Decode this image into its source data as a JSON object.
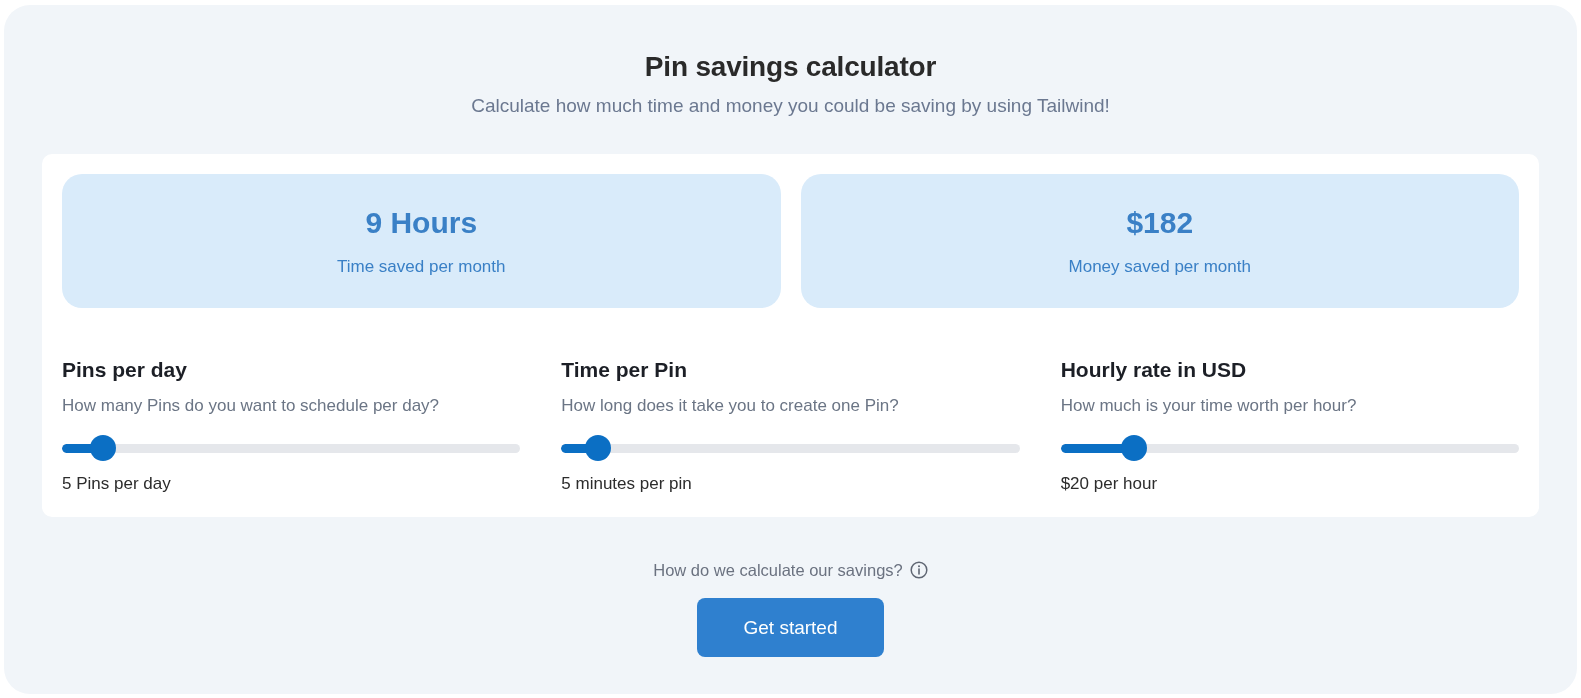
{
  "header": {
    "title": "Pin savings calculator",
    "subtitle": "Calculate how much time and money you could be saving by using Tailwind!"
  },
  "results": [
    {
      "value": "9 Hours",
      "label": "Time saved per month"
    },
    {
      "value": "$182",
      "label": "Money saved per month"
    }
  ],
  "sliders": [
    {
      "title": "Pins per day",
      "question": "How many Pins do you want to schedule per day?",
      "level": 0.09,
      "reading": "5 Pins per day"
    },
    {
      "title": "Time per Pin",
      "question": "How long does it take you to create one Pin?",
      "level": 0.08,
      "reading": "5 minutes per pin"
    },
    {
      "title": "Hourly rate in USD",
      "question": "How much is your time worth per hour?",
      "level": 0.16,
      "reading": "$20 per hour"
    }
  ],
  "footer": {
    "link": "How do we calculate our savings?",
    "button": "Get started"
  }
}
